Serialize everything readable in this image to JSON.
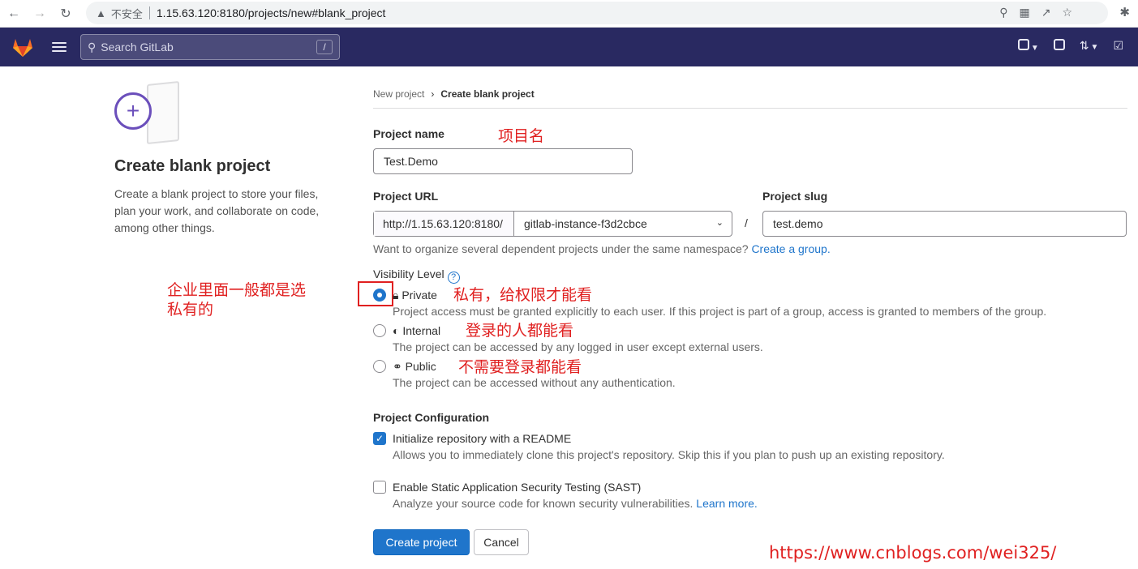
{
  "browser": {
    "insecure_label": "不安全",
    "url": "1.15.63.120:8180/projects/new#blank_project"
  },
  "header": {
    "search_placeholder": "Search GitLab",
    "search_shortcut": "/"
  },
  "left": {
    "title": "Create blank project",
    "description": "Create a blank project to store your files, plan your work, and collaborate on code, among other things."
  },
  "breadcrumb": {
    "parent": "New project",
    "current": "Create blank project"
  },
  "form": {
    "project_name_label": "Project name",
    "project_name_value": "Test.Demo",
    "project_url_label": "Project URL",
    "url_prefix": "http://1.15.63.120:8180/",
    "namespace_value": "gitlab-instance-f3d2cbce",
    "slash": "/",
    "project_slug_label": "Project slug",
    "project_slug_value": "test.demo",
    "namespace_help": "Want to organize several dependent projects under the same namespace?",
    "create_group_link": "Create a group.",
    "visibility_label": "Visibility Level",
    "visibility_options": [
      {
        "label": "Private",
        "help": "Project access must be granted explicitly to each user. If this project is part of a group, access is granted to members of the group.",
        "selected": true
      },
      {
        "label": "Internal",
        "help": "The project can be accessed by any logged in user except external users.",
        "selected": false
      },
      {
        "label": "Public",
        "help": "The project can be accessed without any authentication.",
        "selected": false
      }
    ],
    "config_label": "Project Configuration",
    "readme_label": "Initialize repository with a README",
    "readme_help": "Allows you to immediately clone this project's repository. Skip this if you plan to push up an existing repository.",
    "readme_checked": true,
    "sast_label": "Enable Static Application Security Testing (SAST)",
    "sast_help": "Analyze your source code for known security vulnerabilities.",
    "sast_link": "Learn more.",
    "sast_checked": false,
    "create_button": "Create project",
    "cancel_button": "Cancel"
  },
  "annotations": {
    "project_name_note": "项目名",
    "enterprise_note_line1": "企业里面一般都是选",
    "enterprise_note_line2": "私有的",
    "private_note": "私有，给权限才能看",
    "internal_note": "登录的人都能看",
    "public_note": "不需要登录都能看",
    "watermark": "https://www.cnblogs.com/wei325/"
  },
  "colors": {
    "header_bg": "#292961",
    "primary": "#1f75cb",
    "annotation": "#e02020"
  }
}
